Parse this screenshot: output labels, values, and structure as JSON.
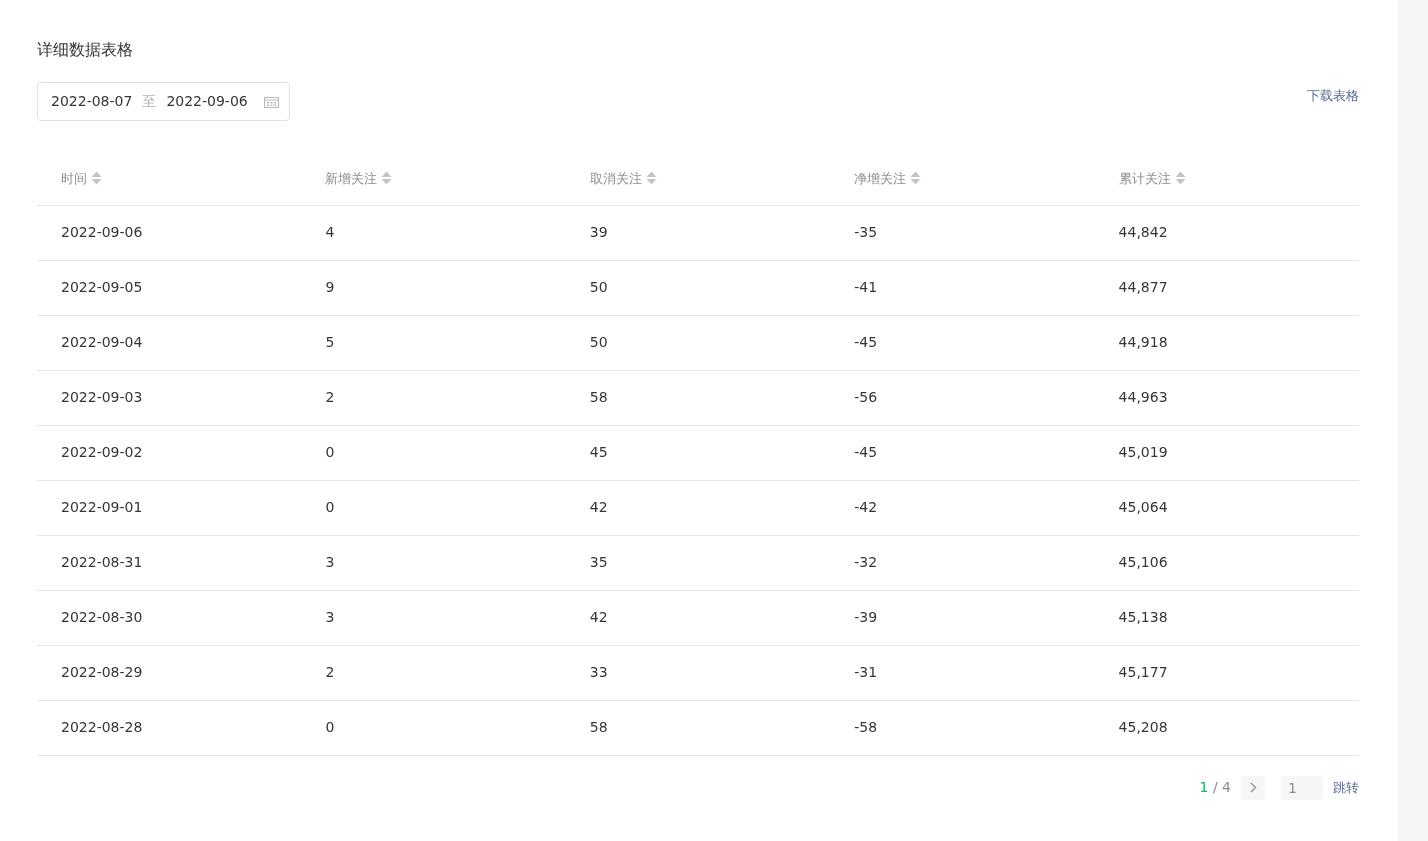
{
  "title": "详细数据表格",
  "date_range": {
    "start": "2022-08-07",
    "separator": "至",
    "end": "2022-09-06"
  },
  "download": "下载表格",
  "table": {
    "columns": [
      "时间",
      "新增关注",
      "取消关注",
      "净增关注",
      "累计关注"
    ],
    "rows": [
      [
        "2022-09-06",
        "4",
        "39",
        "-35",
        "44,842"
      ],
      [
        "2022-09-05",
        "9",
        "50",
        "-41",
        "44,877"
      ],
      [
        "2022-09-04",
        "5",
        "50",
        "-45",
        "44,918"
      ],
      [
        "2022-09-03",
        "2",
        "58",
        "-56",
        "44,963"
      ],
      [
        "2022-09-02",
        "0",
        "45",
        "-45",
        "45,019"
      ],
      [
        "2022-09-01",
        "0",
        "42",
        "-42",
        "45,064"
      ],
      [
        "2022-08-31",
        "3",
        "35",
        "-32",
        "45,106"
      ],
      [
        "2022-08-30",
        "3",
        "42",
        "-39",
        "45,138"
      ],
      [
        "2022-08-29",
        "2",
        "33",
        "-31",
        "45,177"
      ],
      [
        "2022-08-28",
        "0",
        "58",
        "-58",
        "45,208"
      ]
    ]
  },
  "pagination": {
    "current": "1",
    "separator": "/",
    "total": "4",
    "page_input": {
      "placeholder": "1"
    },
    "jump": "跳转"
  }
}
